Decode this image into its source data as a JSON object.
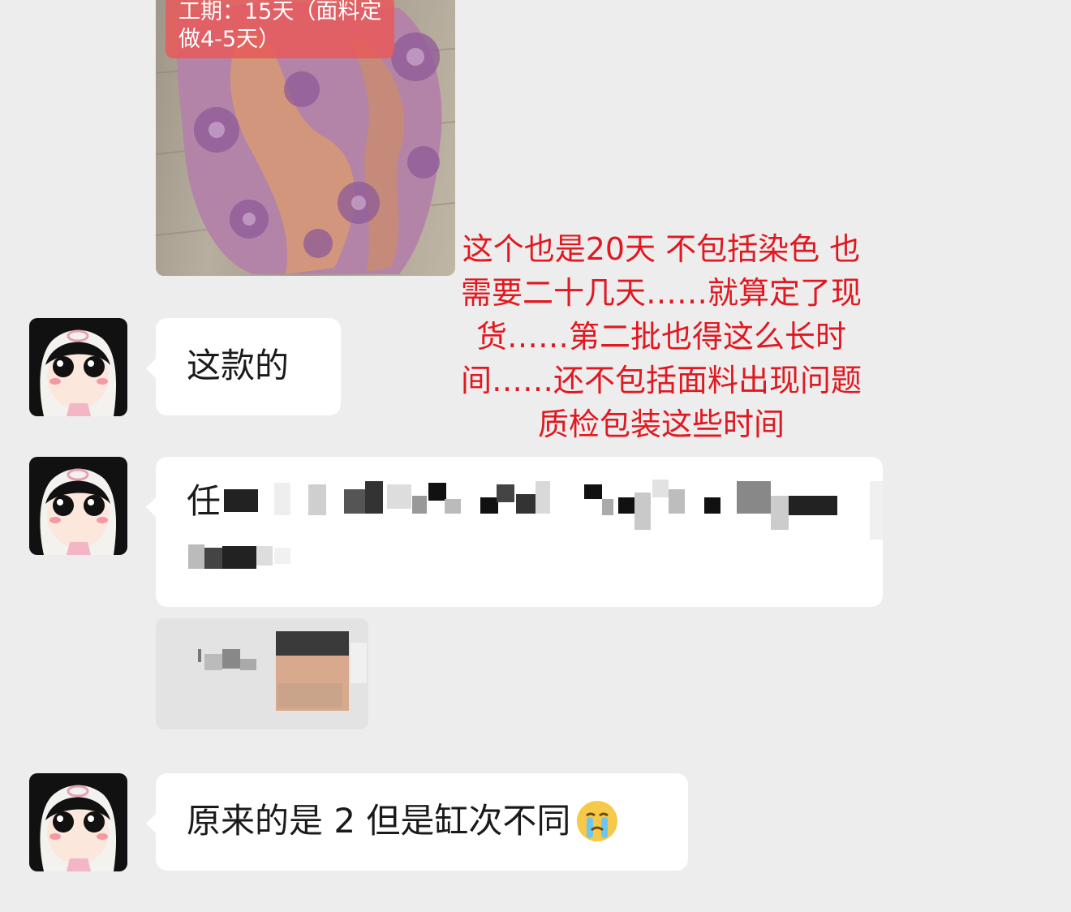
{
  "photo": {
    "label": "工期：15天（面料定做4-5天）"
  },
  "annotation": {
    "lines": [
      "这个也是20天 不包括染色 也",
      "需要二十几天……就算定了现",
      "货……第二批也得这么长时",
      "间……还不包括面料出现问题",
      "质检包装这些时间"
    ]
  },
  "messages": [
    {
      "text": "这款的"
    },
    {
      "text": "任"
    },
    {
      "text": "原来的是 2 但是缸次不同"
    }
  ],
  "emoji": "crying-face",
  "colors": {
    "background": "#ededed",
    "bubble": "#ffffff",
    "annotation": "#e01820",
    "label_bg": "#e85a5a"
  }
}
